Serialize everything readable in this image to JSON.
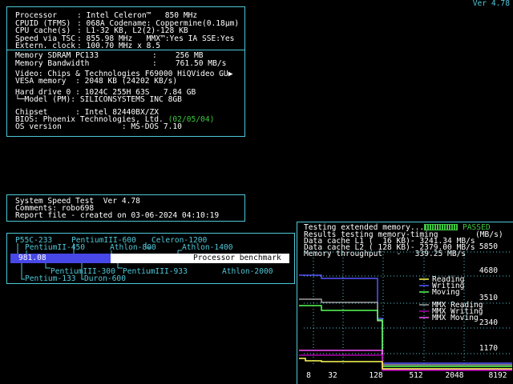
{
  "version": "Ver 4.78",
  "sysinfo": {
    "cpu": [
      [
        "Processor",
        ": Intel Celeron™   850 MHz"
      ],
      [
        "CPUID (TFMS)",
        ": 068A Codename: Coppermine(0.18µm)"
      ],
      [
        "CPU cache(s)",
        ": L1-32 KB, L2(2)-128 KB"
      ],
      [
        "Speed via TSC",
        ": 855.98 MHz   MMX™:Yes IA SSE:Yes"
      ],
      [
        "Extern. clock",
        ": 100.70 MHz x 8.5"
      ]
    ],
    "memory": [
      [
        "Memory SDRAM PC133",
        ":    256 MB"
      ],
      [
        "Memory Bandwidth",
        ":    761.50 MB/s"
      ]
    ],
    "video": "Video: Chips & Technologies F69000 HiQVideo GU",
    "vesa": "VESA memory  : 2048 KB (24202 KB/s)",
    "hdd1": "Hard drive 0 : 1024C 255H 63S   7.84 GB",
    "hdd2": "└─Model (PM): SILICONSYSTEMS INC 8GB",
    "chipset": "Chipset      : Intel 82440BX/ZX",
    "bios": "BIOS: Phoenix Technologies, Ltd. ",
    "bios_date": "(02/05/04)",
    "os": "OS version             : MS-DOS 7.10"
  },
  "report": {
    "line1": "System Speed Test  Ver 4.78",
    "line2": "Comments: robo698",
    "line3": "Report file - created on 03-06-2024 04:10:19"
  },
  "bench": {
    "top_labels": [
      "P55C-233",
      "PentiumIII-600",
      "Celeron-1200",
      "PentiumII-450",
      "Athlon-800",
      "Athlon-1400"
    ],
    "bottom_labels": [
      "PentiumIII-300",
      "PentiumIII-933",
      "Athlon-2000",
      "Pentium-133",
      "Duron-600"
    ],
    "value": "981.08",
    "score": 981.08,
    "bar_fill": 0.36,
    "caption": "Processor benchmark"
  },
  "memtest": {
    "status_text": "Testing extended memory...",
    "passed": "PASSED",
    "header_left": "Results testing memory-timing",
    "header_unit": "(MB/s)",
    "l1": "Data cache L1 (  16 KB)- 3241.34 MB/s",
    "l2": "Data cache L2 ( 128 KB)- 2379.00 MB/s",
    "mem": "Memory throughput   -   339.25 MB/s",
    "yticks": [
      "5850",
      "4680",
      "3510",
      "2340",
      "1170"
    ],
    "xticks": [
      "8",
      "32",
      "128",
      "512",
      "2048",
      "8192"
    ],
    "legend": [
      {
        "label": "Reading",
        "color": "#ffff55"
      },
      {
        "label": "Writing",
        "color": "#5555ff"
      },
      {
        "label": "Moving",
        "color": "#55ff55"
      },
      {
        "label": "MMX Reading",
        "color": "#a0a0a0"
      },
      {
        "label": "MMX Writing",
        "color": "#aa00aa"
      },
      {
        "label": "MMX Moving",
        "color": "#ff55ff"
      }
    ]
  }
}
